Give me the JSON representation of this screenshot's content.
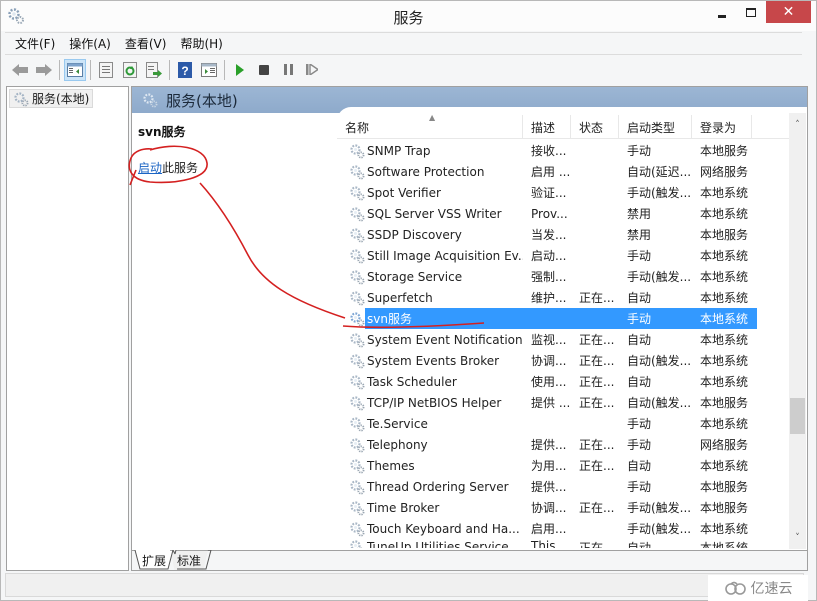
{
  "window": {
    "title": "服务",
    "close_glyph": "✕"
  },
  "menu": {
    "items": [
      {
        "label": "文件(F)"
      },
      {
        "label": "操作(A)"
      },
      {
        "label": "查看(V)"
      },
      {
        "label": "帮助(H)"
      }
    ]
  },
  "toolbar": {
    "buttons": [
      {
        "icon": "back-arrow-icon"
      },
      {
        "icon": "forward-arrow-icon"
      },
      {
        "icon": "show-hide-console-tree-icon",
        "active": true
      },
      {
        "icon": "properties-icon"
      },
      {
        "icon": "refresh-icon"
      },
      {
        "icon": "export-list-icon"
      },
      {
        "icon": "help-icon"
      },
      {
        "icon": "show-hide-action-pane-icon"
      },
      {
        "icon": "start-service-icon"
      },
      {
        "icon": "stop-service-icon"
      },
      {
        "icon": "pause-service-icon"
      },
      {
        "icon": "restart-service-icon"
      }
    ]
  },
  "tree": {
    "root_label": "服务(本地)"
  },
  "pane": {
    "header_title": "服务(本地)",
    "selected_service_name": "svn服务",
    "action_link": "启动",
    "action_suffix": "此服务"
  },
  "list": {
    "columns": {
      "name": "名称",
      "description": "描述",
      "status": "状态",
      "startup_type": "启动类型",
      "logon_as": "登录为"
    },
    "sort_indicator": "▲",
    "rows": [
      {
        "name": "SNMP Trap",
        "description": "接收...",
        "status": "",
        "startup_type": "手动",
        "logon_as": "本地服务"
      },
      {
        "name": "Software Protection",
        "description": "启用 ...",
        "status": "",
        "startup_type": "自动(延迟...",
        "logon_as": "网络服务"
      },
      {
        "name": "Spot Verifier",
        "description": "验证...",
        "status": "",
        "startup_type": "手动(触发...",
        "logon_as": "本地系统"
      },
      {
        "name": "SQL Server VSS Writer",
        "description": "Prov...",
        "status": "",
        "startup_type": "禁用",
        "logon_as": "本地系统"
      },
      {
        "name": "SSDP Discovery",
        "description": "当发...",
        "status": "",
        "startup_type": "禁用",
        "logon_as": "本地服务"
      },
      {
        "name": "Still Image Acquisition Ev...",
        "description": "启动...",
        "status": "",
        "startup_type": "手动",
        "logon_as": "本地系统"
      },
      {
        "name": "Storage Service",
        "description": "强制...",
        "status": "",
        "startup_type": "手动(触发...",
        "logon_as": "本地系统"
      },
      {
        "name": "Superfetch",
        "description": "维护...",
        "status": "正在...",
        "startup_type": "自动",
        "logon_as": "本地系统"
      },
      {
        "name": "svn服务",
        "description": "",
        "status": "",
        "startup_type": "手动",
        "logon_as": "本地系统",
        "selected": true
      },
      {
        "name": "System Event Notification...",
        "description": "监视...",
        "status": "正在...",
        "startup_type": "自动",
        "logon_as": "本地系统"
      },
      {
        "name": "System Events Broker",
        "description": "协调...",
        "status": "正在...",
        "startup_type": "自动(触发...",
        "logon_as": "本地系统"
      },
      {
        "name": "Task Scheduler",
        "description": "使用...",
        "status": "正在...",
        "startup_type": "自动",
        "logon_as": "本地系统"
      },
      {
        "name": "TCP/IP NetBIOS Helper",
        "description": "提供 ...",
        "status": "正在...",
        "startup_type": "自动(触发...",
        "logon_as": "本地服务"
      },
      {
        "name": "Te.Service",
        "description": "",
        "status": "",
        "startup_type": "手动",
        "logon_as": "本地系统"
      },
      {
        "name": "Telephony",
        "description": "提供...",
        "status": "正在...",
        "startup_type": "手动",
        "logon_as": "网络服务"
      },
      {
        "name": "Themes",
        "description": "为用...",
        "status": "正在...",
        "startup_type": "自动",
        "logon_as": "本地系统"
      },
      {
        "name": "Thread Ordering Server",
        "description": "提供...",
        "status": "",
        "startup_type": "手动",
        "logon_as": "本地服务"
      },
      {
        "name": "Time Broker",
        "description": "协调...",
        "status": "正在...",
        "startup_type": "手动(触发...",
        "logon_as": "本地服务"
      },
      {
        "name": "Touch Keyboard and Ha...",
        "description": "启用...",
        "status": "",
        "startup_type": "手动(触发...",
        "logon_as": "本地系统"
      },
      {
        "name": "TuneUp Utilities Service",
        "description": "This...",
        "status": "正在...",
        "startup_type": "自动",
        "logon_as": "本地系统",
        "partial": true
      }
    ],
    "scroll_position": 0.65
  },
  "tabs": [
    {
      "label": "扩展",
      "active": true
    },
    {
      "label": "标准",
      "active": false
    }
  ],
  "watermark": {
    "text": "亿速云"
  },
  "colors": {
    "selection": "#3399ff",
    "pane_header": "#9cb6d4",
    "close_button": "#c7474a",
    "link": "#1a64c4",
    "annotation": "#d42020"
  }
}
